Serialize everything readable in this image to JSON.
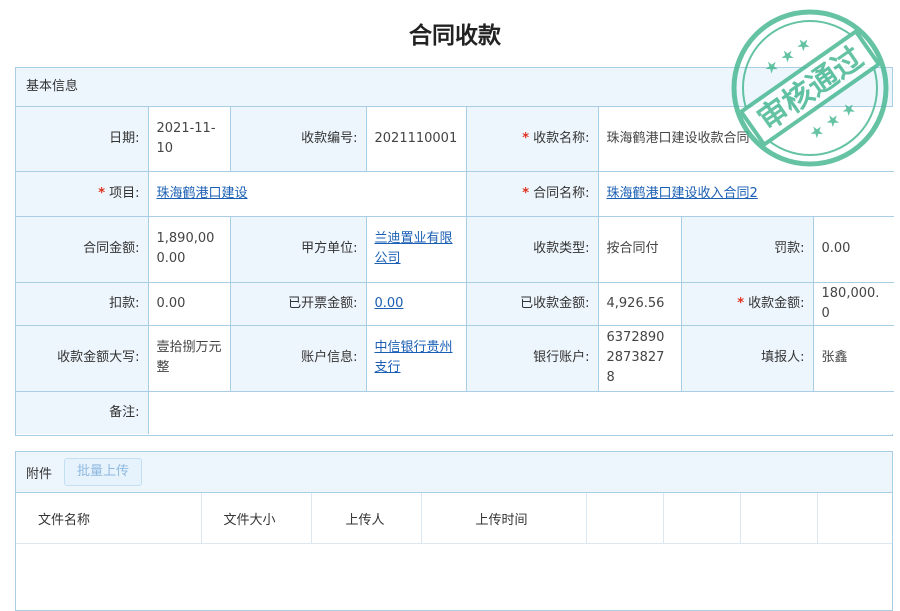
{
  "page": {
    "title": "合同收款"
  },
  "basic": {
    "header": "基本信息",
    "date_label": "日期:",
    "date": "2021-11-10",
    "code_label": "收款编号:",
    "code": "2021110001",
    "name_label": "收款名称:",
    "name": "珠海鹤港口建设收款合同",
    "project_label": "项目:",
    "project": "珠海鹤港口建设",
    "contract_label": "合同名称:",
    "contract": "珠海鹤港口建设收入合同2",
    "amount_label": "合同金额:",
    "amount": "1,890,000.00",
    "party_a_label": "甲方单位:",
    "party_a": "兰迪置业有限公司",
    "type_label": "收款类型:",
    "type": "按合同付",
    "penalty_label": "罚款:",
    "penalty": "0.00",
    "deduct_label": "扣款:",
    "deduct": "0.00",
    "invoiced_label": "已开票金额:",
    "invoiced": "0.00",
    "received_label": "已收款金额:",
    "received": "4,926.56",
    "collect_label": "收款金额:",
    "collect": "180,000.0",
    "upper_label": "收款金额大写:",
    "upper": "壹拾捌万元整",
    "account_label": "账户信息:",
    "account": "中信银行贵州支行",
    "bank_label": "银行账户:",
    "bank": "637289028738278",
    "filler_label": "填报人:",
    "filler": "张鑫",
    "remark_label": "备注:",
    "remark": ""
  },
  "attach": {
    "header": "附件",
    "upload_label": "批量上传",
    "columns": [
      "文件名称",
      "文件大小",
      "上传人",
      "上传时间"
    ]
  },
  "stamp": {
    "text": "审核通过",
    "color": "#3fb58d"
  }
}
